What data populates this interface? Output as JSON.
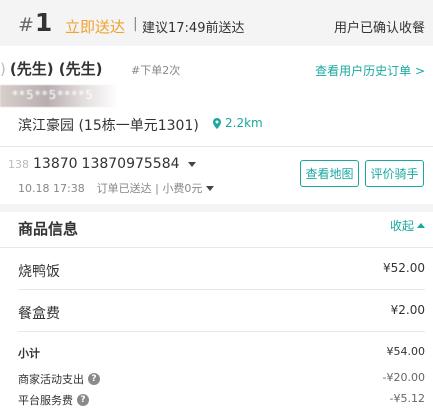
{
  "header": {
    "hash": "#",
    "order_number": "1",
    "delivery_type": "立即送达",
    "separator": "|",
    "eta": "建议17:49前送达",
    "status": "用户已确认收餐"
  },
  "customer": {
    "lead": ")",
    "name": "(先生) (先生)",
    "order_count": "#下单2次",
    "history_link": "查看用户历史订单 >",
    "masked_text": "**5**5****5",
    "address": "滨江豪园 (15栋一单元1301)",
    "distance": "2.2km",
    "phone_ghost": "138",
    "phone_primary": "13870",
    "phone_full": "13870975584",
    "order_time": "10.18 17:38",
    "order_state": "订单已送达 | 小费0元"
  },
  "actions": {
    "view_map": "查看地图",
    "rate_rider": "评价骑手"
  },
  "goods": {
    "title": "商品信息",
    "collapse_label": "收起",
    "items": [
      {
        "name": "烧鸭饭",
        "price": "¥52.00"
      },
      {
        "name": "餐盒费",
        "price": "¥2.00"
      }
    ],
    "subtotal_label": "小计",
    "subtotal_value": "¥54.00",
    "fees": [
      {
        "label": "商家活动支出",
        "value": "-¥20.00"
      },
      {
        "label": "平台服务费",
        "value": "-¥5.12"
      }
    ]
  },
  "colors": {
    "accent": "#19a8a0",
    "delivery_orange": "#f0a22e",
    "header_bg": "#f4f4f4"
  }
}
